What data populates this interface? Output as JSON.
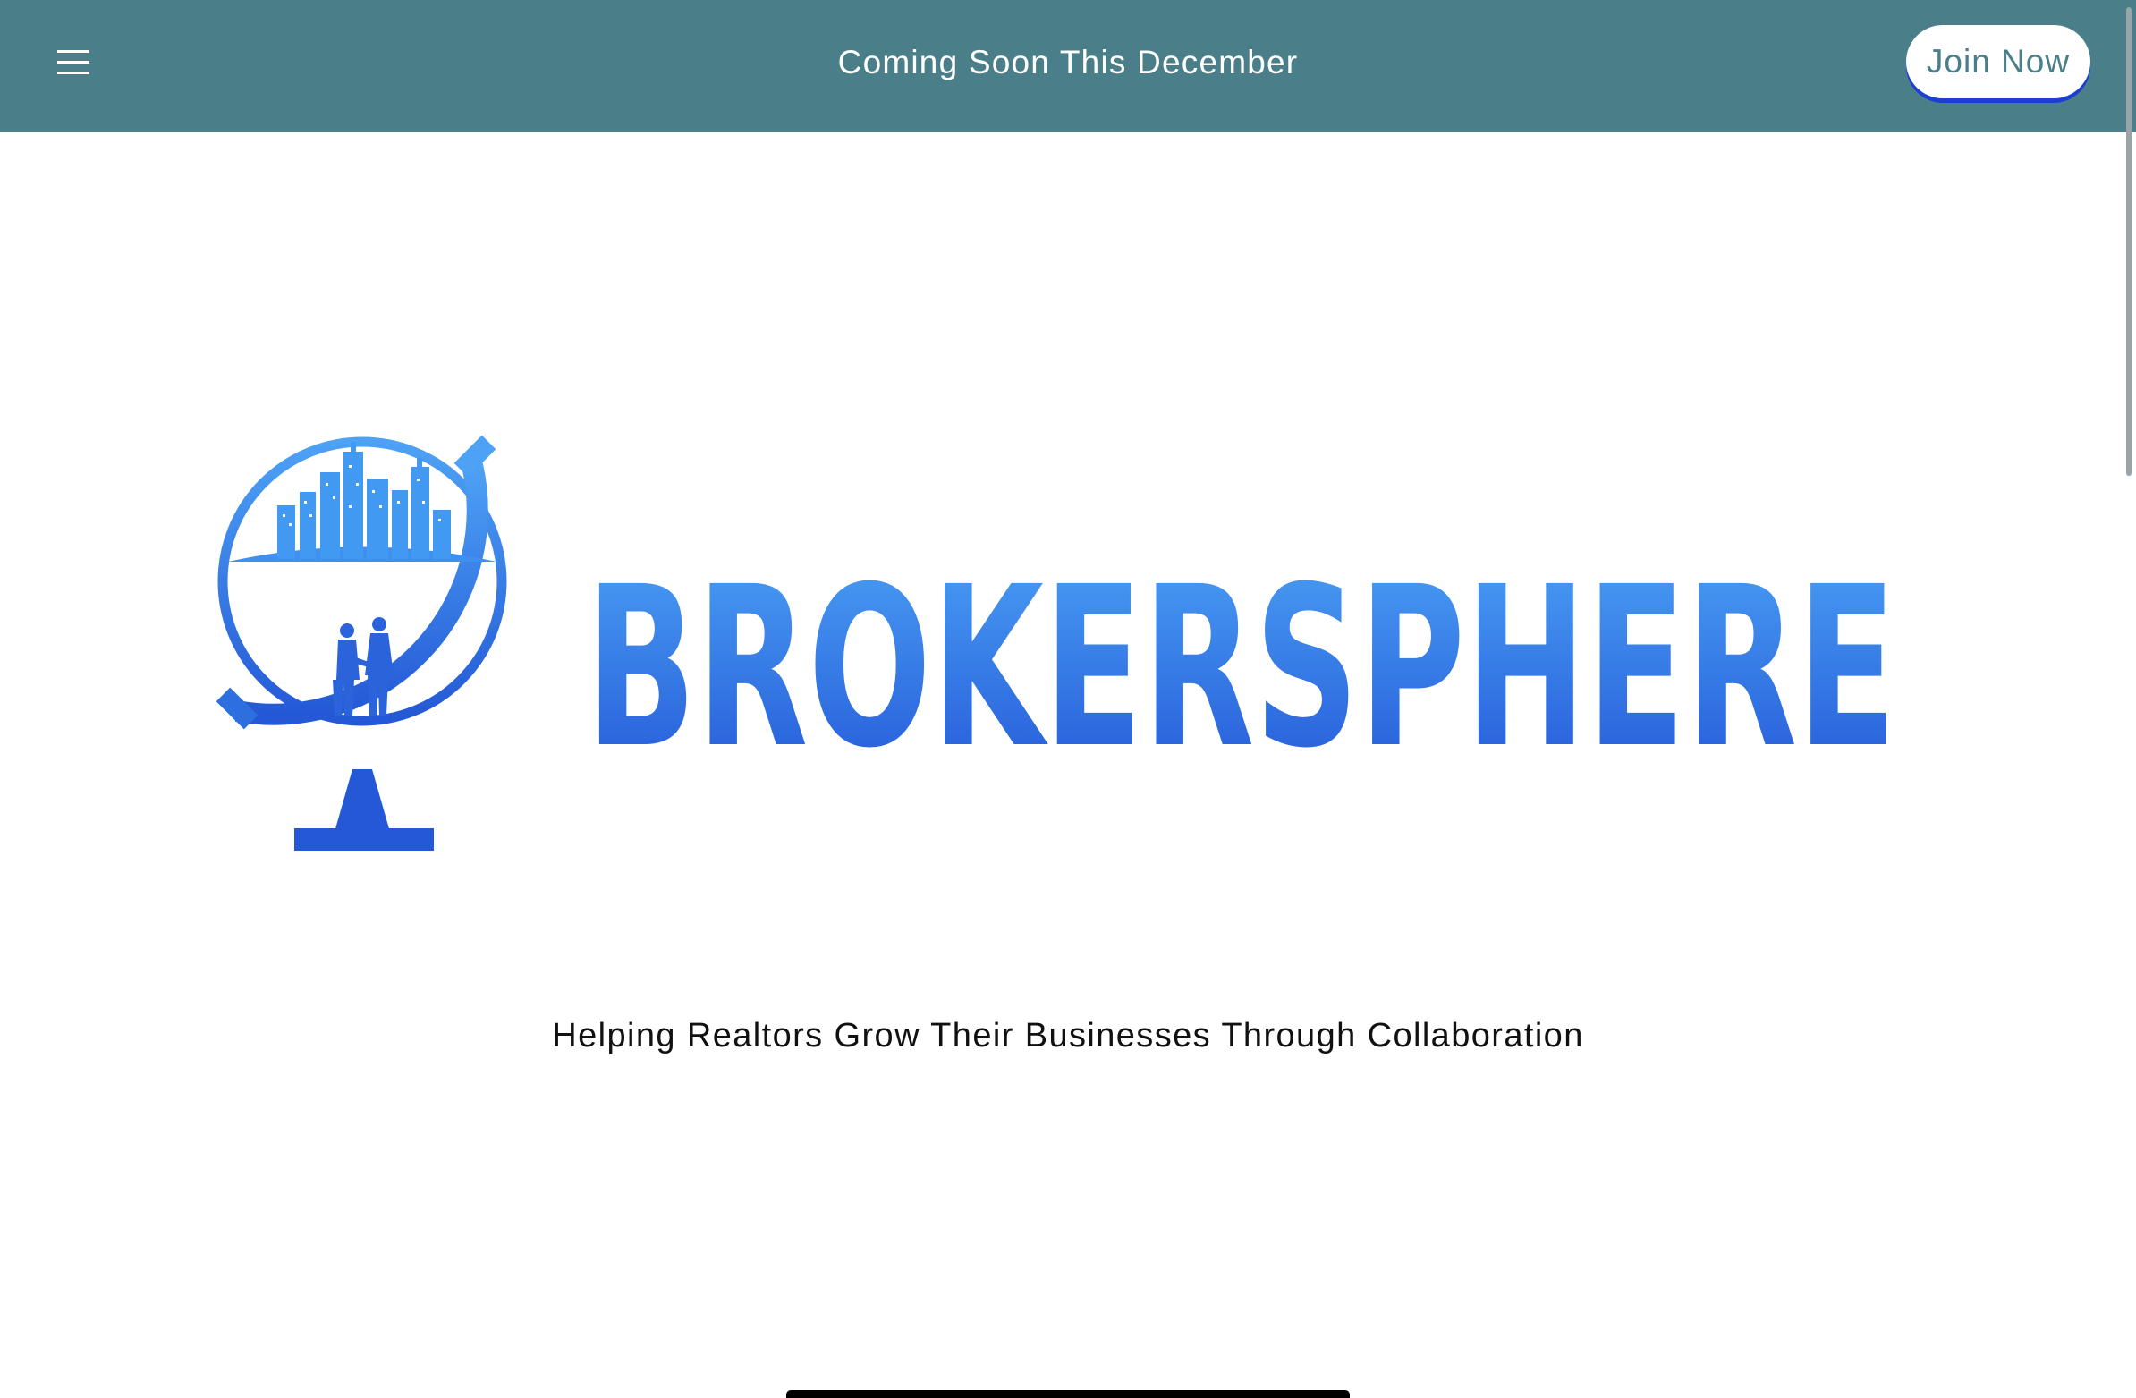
{
  "topbar": {
    "menu_icon": "hamburger-menu-icon",
    "banner_text": "Coming Soon This December",
    "join_button_label": "Join Now",
    "background_color": "#4a7f89",
    "button_shadow_color": "#1c3fd2"
  },
  "logo": {
    "wordmark": "BROKERSPHERE",
    "globe_icon": "globe-with-city-and-handshake-icon",
    "gradient_top": "#4a9cf2",
    "gradient_bottom": "#2356d6"
  },
  "tagline": "Helping Realtors Grow Their Businesses Through Collaboration"
}
